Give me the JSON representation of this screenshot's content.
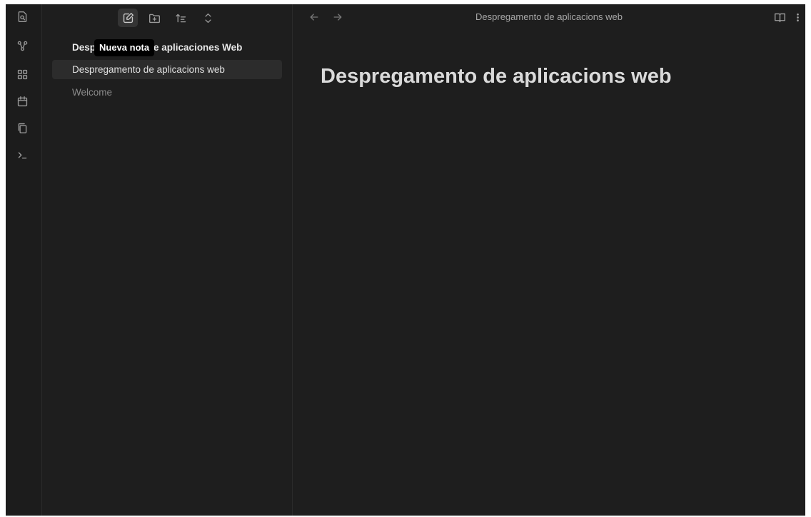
{
  "ribbon": {
    "icons": [
      "quick-switcher-icon",
      "graph-view-icon",
      "canvas-icon",
      "daily-note-icon",
      "templates-icon",
      "command-palette-icon"
    ]
  },
  "explorer": {
    "toolbar": {
      "buttons": [
        "new-note-icon",
        "new-folder-icon",
        "sort-icon",
        "collapse-icon"
      ]
    },
    "tooltip": "Nueva nota",
    "items": [
      {
        "label": "Despregamento de aplicaciones Web",
        "type": "folder"
      },
      {
        "label": "Despregamento de aplicacions web",
        "type": "file",
        "selected": true
      },
      {
        "label": "Welcome",
        "type": "file"
      }
    ]
  },
  "editor": {
    "header_title": "Despregamento de aplicacions web",
    "doc_title": "Despregamento de aplicacions web"
  },
  "colors": {
    "background": "#1e1e1e",
    "ribbon": "#1c1c1c",
    "selected_row": "#2c2c2c",
    "tooltip_bg": "#000000"
  }
}
